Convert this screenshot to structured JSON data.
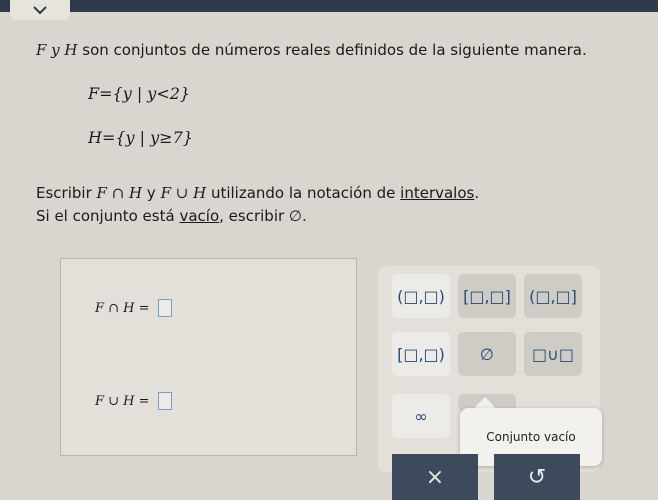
{
  "header": {
    "tab_icon": "chevron-down-icon"
  },
  "problem": {
    "intro_sets": "F y H",
    "intro_rest": "son conjuntos de números reales definidos de la siguiente manera.",
    "def_f": "F={y | y<2}",
    "def_h": "H={y | y≥7}",
    "instr1_prefix": "Escribir",
    "instr1_expr1": "F ∩ H",
    "instr1_mid": "y",
    "instr1_expr2": "F ∪ H",
    "instr1_pre_link": "utilizando la notación de",
    "instr1_link": "intervalos",
    "instr1_end": ".",
    "instr2_prefix": "Si el conjunto está",
    "instr2_link": "vacío",
    "instr2_rest": ", escribir ∅."
  },
  "answers": {
    "row1_label": "F ∩ H =",
    "row2_label": "F ∪ H ="
  },
  "keypad": {
    "keys": [
      "(□,□)",
      "[□,□]",
      "(□,□]",
      "[□,□)",
      "∅",
      "□∪□",
      "∞",
      ""
    ],
    "tooltip": "Conjunto vacío"
  },
  "actions": {
    "clear": "×",
    "undo": "↺"
  },
  "colors": {
    "key_text": "#254a7a",
    "box_border": "#7a9fc7",
    "dark_button": "#3c4a5c"
  }
}
